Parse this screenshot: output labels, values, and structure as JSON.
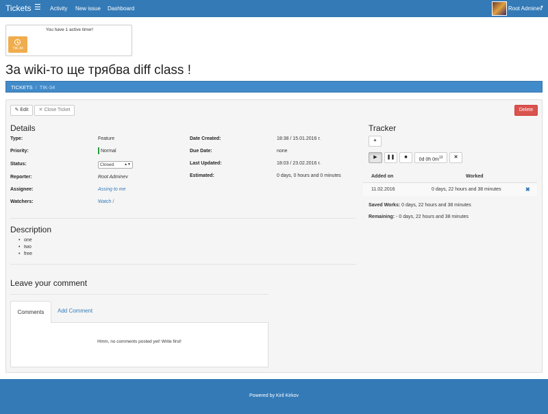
{
  "navbar": {
    "brand": "Tickets",
    "links": [
      "Activity",
      "New issue",
      "Dashboard"
    ],
    "user": "Root Adminev"
  },
  "timer": {
    "message": "You have 1 active timer!",
    "ticket_code": "TIK-34"
  },
  "page_title": "За wiki-то ще трябва diff class !",
  "breadcrumb": [
    "TICKETS",
    "TIK-34"
  ],
  "toolbar": {
    "edit_label": "Edit",
    "close_label": "Close Ticket",
    "delete_label": "Delete"
  },
  "details": {
    "heading": "Details",
    "type_label": "Type:",
    "type_value": "Feature",
    "priority_label": "Priority:",
    "priority_value": "Normal",
    "status_label": "Status:",
    "status_value": "Closed",
    "reporter_label": "Reporter:",
    "reporter_value": "Root Adminev",
    "assignee_label": "Assignee:",
    "assignee_value": "Assing to me",
    "watchers_label": "Watchers:",
    "watchers_value": "Watch /",
    "created_label": "Date Created:",
    "created_value": "18:38 / 15.01.2016 г.",
    "due_label": "Due Date:",
    "due_value": "none",
    "updated_label": "Last Updated:",
    "updated_value": "18:03 / 23.02.2016 г.",
    "estimated_label": "Estimated:",
    "estimated_value": "0 days, 0 hours and 0 minutes"
  },
  "description": {
    "heading": "Description",
    "items": [
      "one",
      "two",
      "free"
    ]
  },
  "comments": {
    "heading": "Leave your comment",
    "tab_comments": "Comments",
    "tab_add": "Add Comment",
    "empty_message": "Hmm, no comments posted yet! Write first!"
  },
  "tracker": {
    "heading": "Tracker",
    "add_symbol": "+",
    "timer_display": "0d 0h 0m",
    "timer_seconds": "13",
    "col_added": "Added on",
    "col_worked": "Worked",
    "rows": [
      {
        "date": "11.02.2016",
        "worked": "0 days, 22 hours and 38 minutes"
      }
    ],
    "saved_label": "Saved Works:",
    "saved_value": "0 days, 22 hours and 38 minutes",
    "remaining_label": "Remaining:",
    "remaining_value": "- 0 days, 22 hours and 38 minutes"
  },
  "footer": {
    "text": "Powered by Kiril Kirkov"
  },
  "colors": {
    "primary": "#337ab7",
    "timer_tile": "#f0ad4e",
    "delete": "#d9534f",
    "priority_normal": "#2a9b3e"
  }
}
